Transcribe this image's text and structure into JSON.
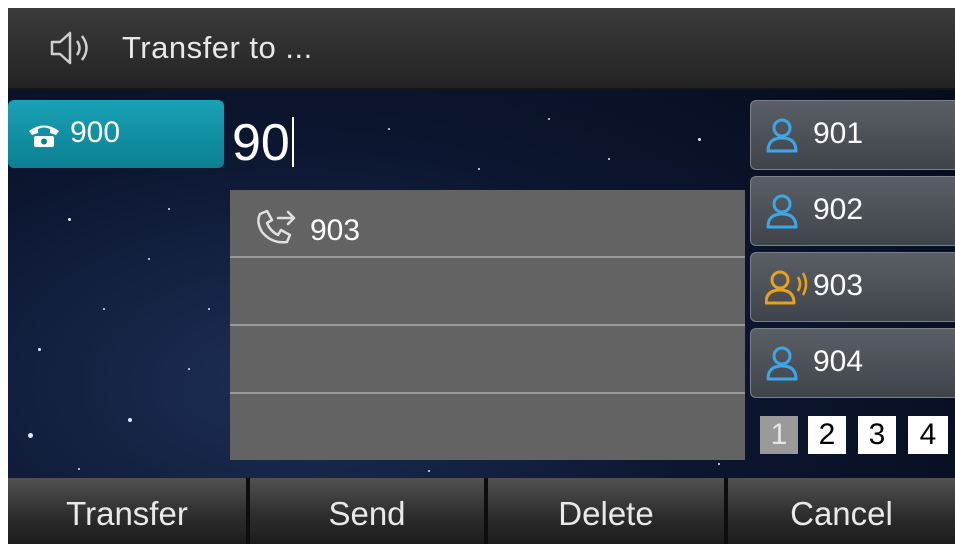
{
  "header": {
    "title": "Transfer to ...",
    "icon": "speaker-icon"
  },
  "line_key": {
    "label": "900",
    "icon": "phone-icon",
    "color": "#1197aa"
  },
  "dial_input": {
    "value": "90"
  },
  "suggestions": [
    {
      "label": "903",
      "icon": "call-forward-icon"
    },
    {
      "label": ""
    },
    {
      "label": ""
    },
    {
      "label": ""
    }
  ],
  "contacts": [
    {
      "name": "901",
      "icon": "contact-icon",
      "status_color": "#3aa8e8"
    },
    {
      "name": "902",
      "icon": "contact-icon",
      "status_color": "#3aa8e8"
    },
    {
      "name": "903",
      "icon": "contact-talking-icon",
      "status_color": "#e8a21a"
    },
    {
      "name": "904",
      "icon": "contact-icon",
      "status_color": "#3aa8e8"
    }
  ],
  "pager": {
    "pages": [
      "1",
      "2",
      "3",
      "4"
    ],
    "current": "1"
  },
  "softkeys": {
    "k1": "Transfer",
    "k2": "Send",
    "k3": "Delete",
    "k4": "Cancel"
  }
}
